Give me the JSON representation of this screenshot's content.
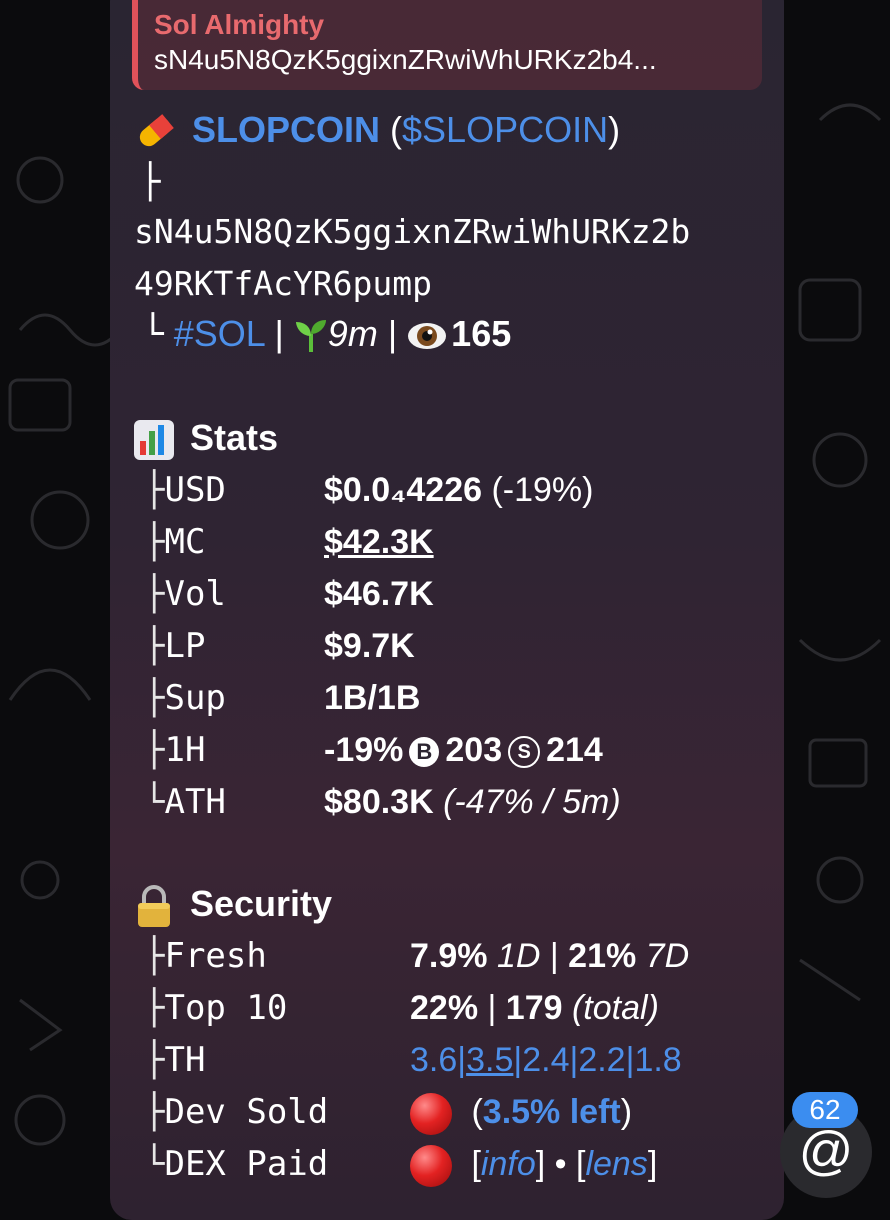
{
  "reply": {
    "author": "Sol Almighty",
    "preview": "sN4u5N8QzK5ggixnZRwiWhURKz2b4..."
  },
  "token": {
    "icon": "pill-icon",
    "name": "SLOPCOIN",
    "open_paren": " (",
    "ticker": "$SLOPCOIN",
    "close_paren": ")",
    "tree_top": "├",
    "address_line1": "sN4u5N8QzK5ggixnZRwiWhURKz2b",
    "address_line2": "49RKTfAcYR6pump",
    "tree_end": "└",
    "chain": "#SOL",
    "sep": " | ",
    "age": "9m",
    "views": "165"
  },
  "stats": {
    "icon": "bar-chart-icon",
    "title": "Stats",
    "rows": [
      {
        "tree": "├",
        "key": "USD",
        "value": "$0.0₄4226",
        "extra": " (-19%)"
      },
      {
        "tree": "├",
        "key": "MC",
        "value": "$42.3K",
        "extra": ""
      },
      {
        "tree": "├",
        "key": "Vol",
        "value": "$46.7K",
        "extra": ""
      },
      {
        "tree": "├",
        "key": "LP",
        "value": "$9.7K",
        "extra": ""
      },
      {
        "tree": "├",
        "key": "Sup",
        "value": "1B/1B",
        "extra": ""
      },
      {
        "tree": "├",
        "key": "1H",
        "value": "-19%",
        "buys_glyph": "B",
        "buys": "203",
        "sells_glyph": "S",
        "sells": "214"
      },
      {
        "tree": "└",
        "key": "ATH",
        "value": "$80.3K",
        "extra": "(-47% / 5m)"
      }
    ]
  },
  "security": {
    "icon": "lock-icon",
    "title": "Security",
    "fresh": {
      "tree": "├",
      "key": "Fresh",
      "v1": "7.9%",
      "l1": "1D",
      "sep": " | ",
      "v2": "21%",
      "l2": "7D"
    },
    "top10": {
      "tree": "├",
      "key": "Top 10",
      "v1": "22%",
      "sep": " | ",
      "v2": "179",
      "l2": "(total)"
    },
    "th": {
      "tree": "├",
      "key": "TH",
      "values": [
        "3.6",
        "3.5",
        "2.4",
        "2.2",
        "1.8"
      ],
      "sep": "|"
    },
    "dev_sold": {
      "tree": "├",
      "key": "Dev Sold",
      "open": " (",
      "value": "3.5% left",
      "close": ")"
    },
    "dex_paid": {
      "tree": "└",
      "key": "DEX Paid",
      "open": " [",
      "info": "info",
      "mid": "] • [",
      "lens": "lens",
      "close": "]"
    }
  },
  "mention_badge": {
    "count": "62",
    "symbol": "@"
  },
  "colors": {
    "link": "#4d8fe8",
    "reply_accent": "#e0525a",
    "badge": "#3b8df0",
    "red_dot": "#e32222"
  }
}
